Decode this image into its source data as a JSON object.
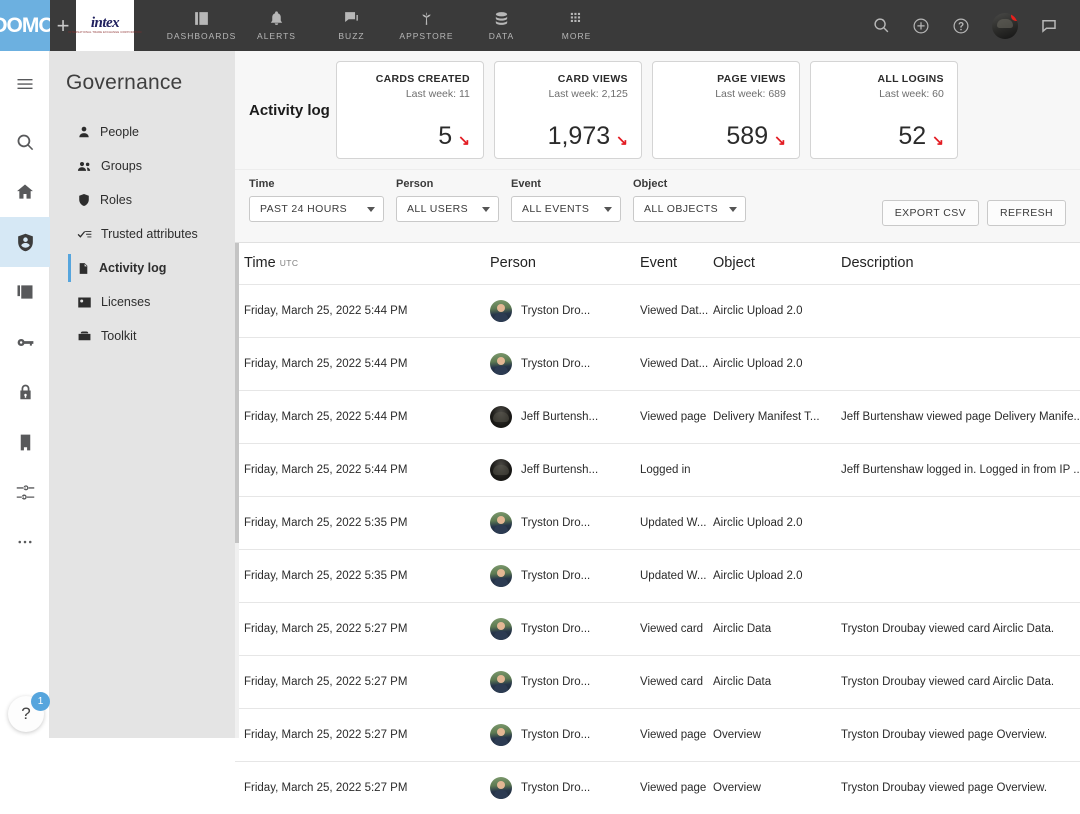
{
  "topnav": {
    "brand": "DOMO",
    "add_tab_label": "+",
    "active_tab": {
      "name": "intex",
      "wordmark": "intex",
      "tagline": "INTERNATIONAL TRADE EXCHANGE CORPORATION"
    },
    "items": [
      {
        "label": "DASHBOARDS",
        "icon": "dashboards-icon"
      },
      {
        "label": "ALERTS",
        "icon": "bell-icon"
      },
      {
        "label": "BUZZ",
        "icon": "chat-icon"
      },
      {
        "label": "APPSTORE",
        "icon": "appstore-icon"
      },
      {
        "label": "DATA",
        "icon": "database-icon"
      },
      {
        "label": "MORE",
        "icon": "grid-icon"
      }
    ],
    "right_icons": [
      {
        "name": "search-icon"
      },
      {
        "name": "add-circle-icon"
      },
      {
        "name": "help-circle-icon"
      },
      {
        "name": "user-avatar"
      },
      {
        "name": "buzz-chat-icon"
      }
    ],
    "notification_badge": ""
  },
  "rail": {
    "items": [
      {
        "name": "menu-icon"
      },
      {
        "name": "search-icon"
      },
      {
        "name": "home-icon"
      },
      {
        "name": "governance-icon",
        "selected": true
      },
      {
        "name": "cards-icon"
      },
      {
        "name": "key-icon"
      },
      {
        "name": "lock-icon"
      },
      {
        "name": "company-icon"
      },
      {
        "name": "settings-sliders-icon"
      },
      {
        "name": "more-dots-icon"
      }
    ],
    "help": {
      "glyph": "?",
      "badge": "1"
    }
  },
  "sidebar": {
    "title": "Governance",
    "items": [
      {
        "label": "People",
        "icon": "person-icon",
        "active": false
      },
      {
        "label": "Groups",
        "icon": "group-icon",
        "active": false
      },
      {
        "label": "Roles",
        "icon": "shield-icon",
        "active": false
      },
      {
        "label": "Trusted attributes",
        "icon": "check-list-icon",
        "active": false
      },
      {
        "label": "Activity log",
        "icon": "document-icon",
        "active": true
      },
      {
        "label": "Licenses",
        "icon": "id-card-icon",
        "active": false
      },
      {
        "label": "Toolkit",
        "icon": "toolbox-icon",
        "active": false
      }
    ]
  },
  "main": {
    "page_title": "Activity log",
    "kpis": [
      {
        "label": "CARDS CREATED",
        "subtitle": "Last week: 11",
        "value": "5",
        "trend": "down",
        "arrow": "↘"
      },
      {
        "label": "CARD VIEWS",
        "subtitle": "Last week: 2,125",
        "value": "1,973",
        "trend": "down",
        "arrow": "↘"
      },
      {
        "label": "PAGE VIEWS",
        "subtitle": "Last week: 689",
        "value": "589",
        "trend": "down",
        "arrow": "↘"
      },
      {
        "label": "ALL LOGINS",
        "subtitle": "Last week: 60",
        "value": "52",
        "trend": "down",
        "arrow": "↘"
      }
    ],
    "filters": [
      {
        "label": "Time",
        "value": "PAST 24 HOURS"
      },
      {
        "label": "Person",
        "value": "ALL USERS"
      },
      {
        "label": "Event",
        "value": "ALL EVENTS"
      },
      {
        "label": "Object",
        "value": "ALL OBJECTS"
      }
    ],
    "actions": [
      {
        "label": "EXPORT CSV"
      },
      {
        "label": "REFRESH"
      }
    ],
    "table": {
      "columns": [
        {
          "label": "Time",
          "note": "UTC"
        },
        {
          "label": "Person",
          "note": ""
        },
        {
          "label": "Event",
          "note": ""
        },
        {
          "label": "Object",
          "note": ""
        },
        {
          "label": "Description",
          "note": ""
        }
      ],
      "rows": [
        {
          "time": "Friday, March 25, 2022 5:44 PM",
          "person": "Tryston Dro...",
          "avatar": "t",
          "event": "Viewed Dat...",
          "object": "Airclic Upload 2.0",
          "description": ""
        },
        {
          "time": "Friday, March 25, 2022 5:44 PM",
          "person": "Tryston Dro...",
          "avatar": "t",
          "event": "Viewed Dat...",
          "object": "Airclic Upload 2.0",
          "description": ""
        },
        {
          "time": "Friday, March 25, 2022 5:44 PM",
          "person": "Jeff Burtensh...",
          "avatar": "j",
          "event": "Viewed page",
          "object": "Delivery Manifest T...",
          "description": "Jeff Burtenshaw viewed page Delivery Manife..."
        },
        {
          "time": "Friday, March 25, 2022 5:44 PM",
          "person": "Jeff Burtensh...",
          "avatar": "j",
          "event": "Logged in",
          "object": "",
          "description": "Jeff Burtenshaw logged in. Logged in from IP ..."
        },
        {
          "time": "Friday, March 25, 2022 5:35 PM",
          "person": "Tryston Dro...",
          "avatar": "t",
          "event": "Updated W...",
          "object": "Airclic Upload 2.0",
          "description": ""
        },
        {
          "time": "Friday, March 25, 2022 5:35 PM",
          "person": "Tryston Dro...",
          "avatar": "t",
          "event": "Updated W...",
          "object": "Airclic Upload 2.0",
          "description": ""
        },
        {
          "time": "Friday, March 25, 2022 5:27 PM",
          "person": "Tryston Dro...",
          "avatar": "t",
          "event": "Viewed card",
          "object": "Airclic Data",
          "description": "Tryston Droubay viewed card Airclic Data."
        },
        {
          "time": "Friday, March 25, 2022 5:27 PM",
          "person": "Tryston Dro...",
          "avatar": "t",
          "event": "Viewed card",
          "object": "Airclic Data",
          "description": "Tryston Droubay viewed card Airclic Data."
        },
        {
          "time": "Friday, March 25, 2022 5:27 PM",
          "person": "Tryston Dro...",
          "avatar": "t",
          "event": "Viewed page",
          "object": "Overview",
          "description": "Tryston Droubay viewed page Overview."
        },
        {
          "time": "Friday, March 25, 2022 5:27 PM",
          "person": "Tryston Dro...",
          "avatar": "t",
          "event": "Viewed page",
          "object": "Overview",
          "description": "Tryston Droubay viewed page Overview."
        }
      ]
    }
  },
  "colors": {
    "brand_blue": "#6cb0e0",
    "topnav_bg": "#3a3a3a",
    "sidebar_bg": "#e4e4e4",
    "accent_selected": "#d6e8f5",
    "trend_down": "#e31c23",
    "notification": "#e8201c"
  }
}
